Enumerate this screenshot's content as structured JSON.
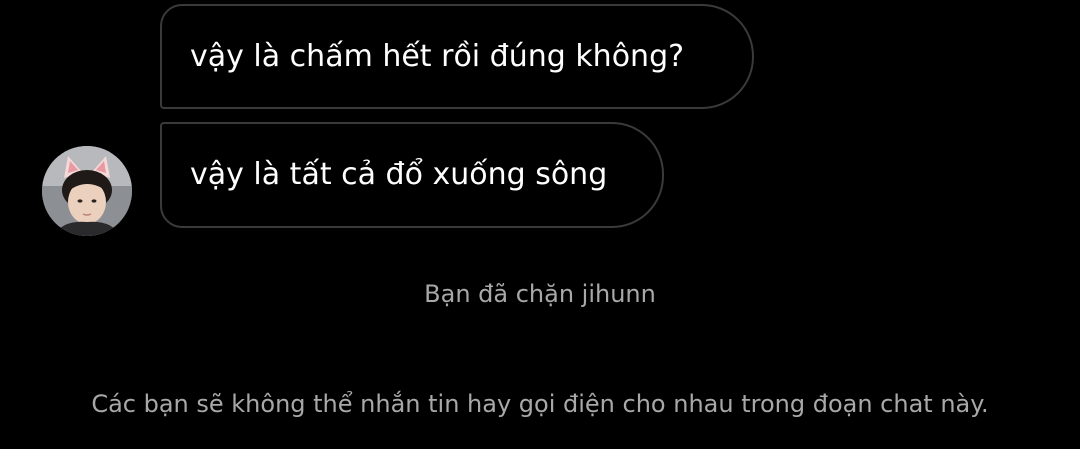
{
  "conversation": {
    "messages": [
      {
        "text": "vậy là chấm hết rồi đúng không?"
      },
      {
        "text": "vậy là tất cả đổ xuống sông"
      }
    ],
    "avatar_icon": "user-avatar-photo"
  },
  "block_notice": {
    "title": "Bạn đã chặn jihunn",
    "subtitle": "Các bạn sẽ không thể nhắn tin hay gọi điện cho nhau trong đoạn chat này."
  },
  "colors": {
    "background": "#000000",
    "bubble_border": "#3a3a3a",
    "message_text": "#ffffff",
    "system_text": "#a8a8a8"
  }
}
